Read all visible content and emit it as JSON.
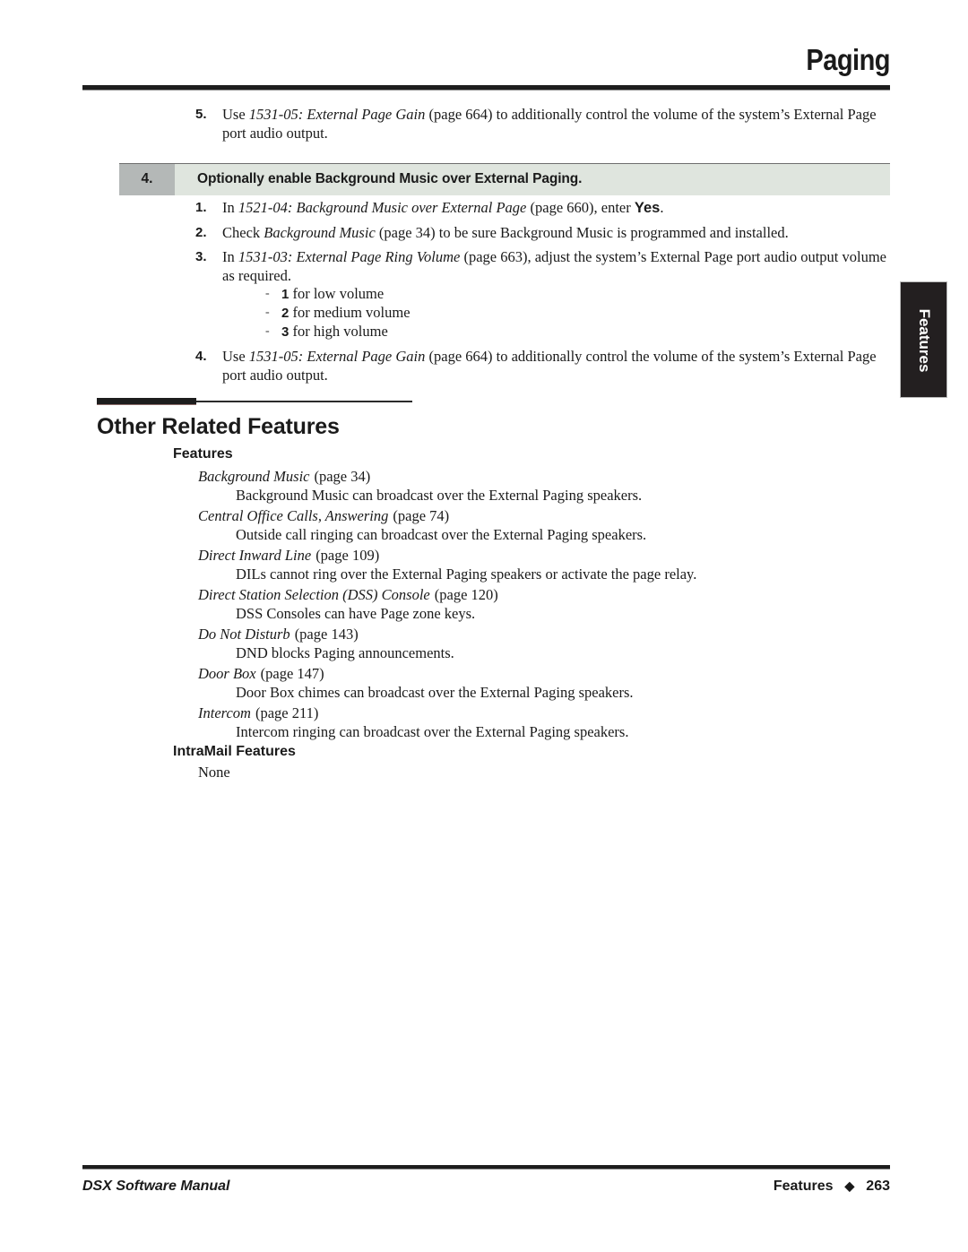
{
  "header": {
    "title": "Paging"
  },
  "side_tab": {
    "label": "Features"
  },
  "top_step": {
    "number": "5.",
    "text_1": "Use ",
    "ref_italic": "1531-05: External Page Gain",
    "text_2": " (page 664) to additionally control the volume of the system’s External Page port audio output."
  },
  "banner": {
    "number": "4.",
    "text": "Optionally enable Background Music over External Paging."
  },
  "steps": [
    {
      "number": "1.",
      "pre": "In ",
      "ref_italic": "1521-04: Background Music over External Page",
      "mid": " (page 660), enter ",
      "bold_value": "Yes",
      "post": "."
    },
    {
      "number": "2.",
      "pre": "Check ",
      "ref_italic": "Background Music",
      "mid": " (page 34) to be sure Background Music is programmed and installed.",
      "bold_value": "",
      "post": ""
    },
    {
      "number": "3.",
      "pre": "In ",
      "ref_italic": "1531-03: External Page Ring Volume",
      "mid": " (page 663), adjust the system’s External Page port audio output volume as required.",
      "bold_value": "",
      "post": "",
      "substeps": [
        {
          "dash": "-",
          "key": "1",
          "text": " for low volume"
        },
        {
          "dash": "-",
          "key": "2",
          "text": " for medium volume"
        },
        {
          "dash": "-",
          "key": "3",
          "text": " for high volume"
        }
      ]
    },
    {
      "number": "4.",
      "pre": "Use ",
      "ref_italic": "1531-05: External Page Gain",
      "mid": " (page 664) to additionally control the volume of the system’s External Page port audio output.",
      "bold_value": "",
      "post": ""
    }
  ],
  "section": {
    "title": "Other Related Features",
    "features_heading": "Features",
    "features": [
      {
        "title": "Background Music",
        "page": "(page 34)",
        "desc": "Background Music can broadcast over the External Paging speakers."
      },
      {
        "title": "Central Office Calls, Answering",
        "page": "(page 74)",
        "desc": "Outside call ringing can broadcast over the External Paging speakers."
      },
      {
        "title": "Direct Inward Line",
        "page": "(page 109)",
        "desc": "DILs cannot ring over the External Paging speakers or activate the page relay."
      },
      {
        "title": "Direct Station Selection (DSS) Console",
        "page": "(page 120)",
        "desc": "DSS Consoles can have Page zone keys."
      },
      {
        "title": "Do Not Disturb",
        "page": "(page 143)",
        "desc": "DND blocks Paging announcements."
      },
      {
        "title": "Door Box",
        "page": "(page 147)",
        "desc": "Door Box chimes can broadcast over the External Paging speakers."
      },
      {
        "title": "Intercom",
        "page": "(page 211)",
        "desc": "Intercom ringing can broadcast over the External Paging speakers."
      }
    ],
    "intramail_heading": "IntraMail Features",
    "intramail_value": "None"
  },
  "footer": {
    "left": "DSX Software Manual",
    "section": "Features",
    "diamond": "◆",
    "page_number": "263"
  }
}
